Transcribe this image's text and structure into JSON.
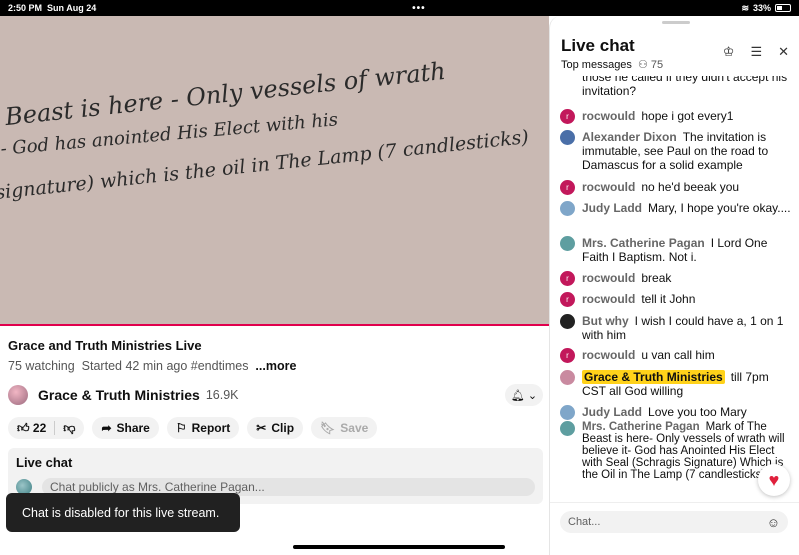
{
  "status": {
    "time": "2:50 PM",
    "date": "Sun Aug 24",
    "battery": "33%"
  },
  "video": {
    "board_lines": [
      "Beast is here - Only vessels of wrath",
      "- God has anointed His Elect with his",
      "signature) which is the oil in The Lamp (7 candlesticks)"
    ]
  },
  "details": {
    "title": "Grace and Truth Ministries Live",
    "watching": "75 watching",
    "started": "Started 42 min ago",
    "hashtag": "#endtimes",
    "more": "...more",
    "channel_name": "Grace & Truth Ministries",
    "subscribers": "16.9K",
    "likes": "22",
    "share": "Share",
    "report": "Report",
    "clip": "Clip",
    "save": "Save"
  },
  "live_chat_box": {
    "title": "Live chat",
    "placeholder": "Chat publicly as Mrs. Catherine Pagan..."
  },
  "toast": "Chat is disabled for this live stream.",
  "chat": {
    "title": "Live chat",
    "mode": "Top messages",
    "viewers": "75",
    "input_placeholder": "Chat...",
    "messages": [
      {
        "author": "",
        "text": "those he called if they didn't accept his invitation?"
      },
      {
        "author": "rocwould",
        "text": "hope i got every1"
      },
      {
        "author": "Alexander Dixon",
        "text": "The invitation is immutable, see Paul on the road to Damascus for a solid example"
      },
      {
        "author": "rocwould",
        "text": "no he'd beeak you"
      },
      {
        "author": "Judy Ladd",
        "text": "Mary, I hope you're okay...."
      },
      {
        "author": "Mrs. Catherine Pagan",
        "text": "I Lord One Faith I Baptism. Not i."
      },
      {
        "author": "rocwould",
        "text": "break"
      },
      {
        "author": "rocwould",
        "text": "tell it John"
      },
      {
        "author": "But why",
        "text": "I wish I could have a, 1 on 1 with him"
      },
      {
        "author": "rocwould",
        "text": "u van call him"
      },
      {
        "author": "Grace & Truth Ministries",
        "text": "till 7pm CST all God willing"
      },
      {
        "author": "Judy Ladd",
        "text": "Love you too Mary"
      },
      {
        "author": "Mrs. Catherine Pagan",
        "text": "Mark of The Beast is here- Only vessels of wrath will believe it- God has Anointed His Elect with Seal (Schragis Signature) Which is the Oil in The Lamp (7 candlesticks)"
      }
    ]
  }
}
